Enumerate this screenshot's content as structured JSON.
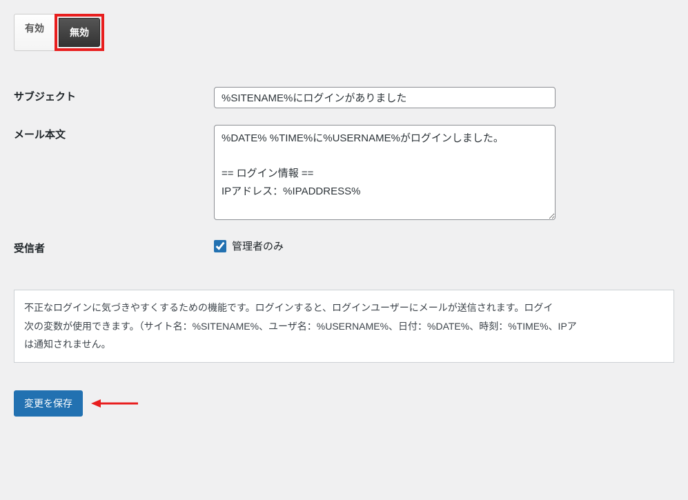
{
  "toggle": {
    "enabled_label": "有効",
    "disabled_label": "無効"
  },
  "subject": {
    "label": "サブジェクト",
    "value": "%SITENAME%にログインがありました"
  },
  "body": {
    "label": "メール本文",
    "value": "%DATE% %TIME%に%USERNAME%がログインしました。\n\n== ログイン情報 ==\nIPアドレス：%IPADDRESS%"
  },
  "recipient": {
    "label": "受信者",
    "checkbox_label": "管理者のみ",
    "checked": true
  },
  "description": {
    "line1": "不正なログインに気づきやすくするための機能です。ログインすると、ログインユーザーにメールが送信されます。ログイ",
    "line2": "次の変数が使用できます。（サイト名：%SITENAME%、ユーザ名：%USERNAME%、日付：%DATE%、時刻：%TIME%、IPア",
    "line3": "は通知されません。"
  },
  "submit": {
    "label": "変更を保存"
  }
}
